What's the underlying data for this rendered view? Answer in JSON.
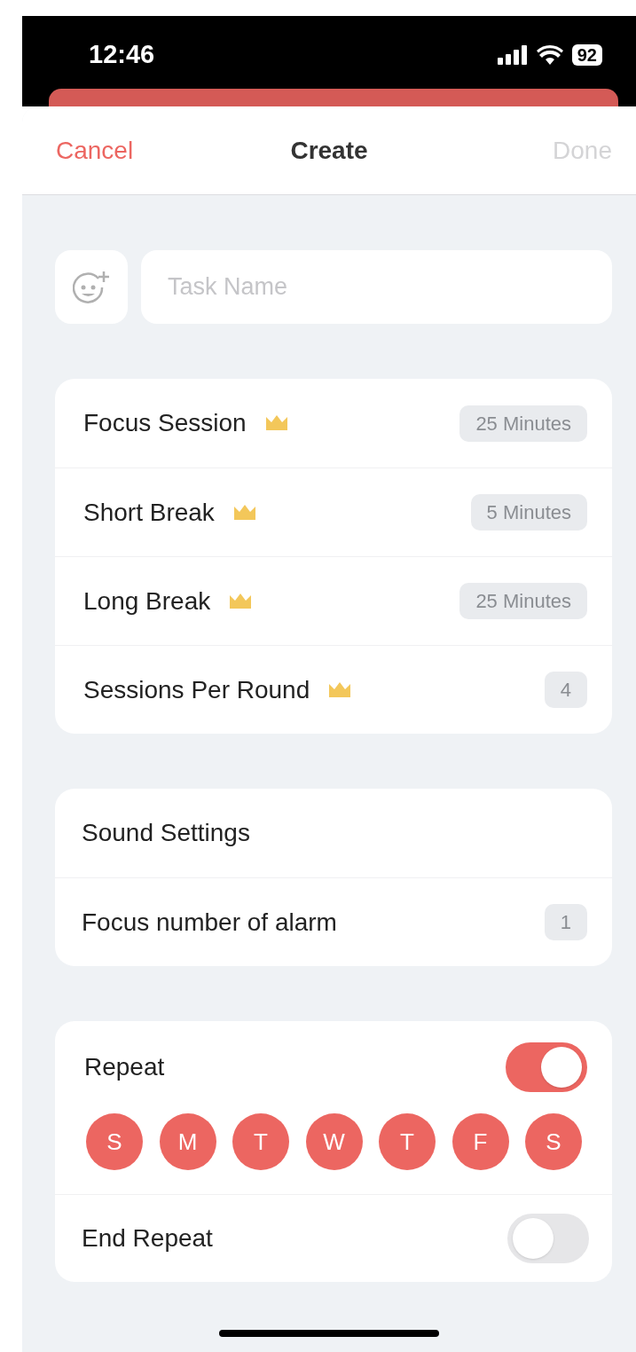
{
  "status_bar": {
    "time": "12:46",
    "battery": "92"
  },
  "header": {
    "cancel": "Cancel",
    "title": "Create",
    "done": "Done",
    "done_disabled": true
  },
  "task": {
    "placeholder": "Task Name"
  },
  "timer_settings": [
    {
      "label": "Focus Session",
      "premium": true,
      "value": "25 Minutes"
    },
    {
      "label": "Short Break",
      "premium": true,
      "value": "5 Minutes"
    },
    {
      "label": "Long Break",
      "premium": true,
      "value": "25 Minutes"
    },
    {
      "label": "Sessions Per Round",
      "premium": true,
      "value": "4"
    }
  ],
  "sound_settings": [
    {
      "label": "Sound Settings"
    },
    {
      "label": "Focus number of alarm",
      "value": "1"
    }
  ],
  "repeat": {
    "label": "Repeat",
    "on": true,
    "days": [
      {
        "label": "S",
        "selected": true
      },
      {
        "label": "M",
        "selected": true
      },
      {
        "label": "T",
        "selected": true
      },
      {
        "label": "W",
        "selected": true
      },
      {
        "label": "T",
        "selected": true
      },
      {
        "label": "F",
        "selected": true
      },
      {
        "label": "S",
        "selected": true
      }
    ]
  },
  "end_repeat": {
    "label": "End Repeat",
    "on": false
  }
}
